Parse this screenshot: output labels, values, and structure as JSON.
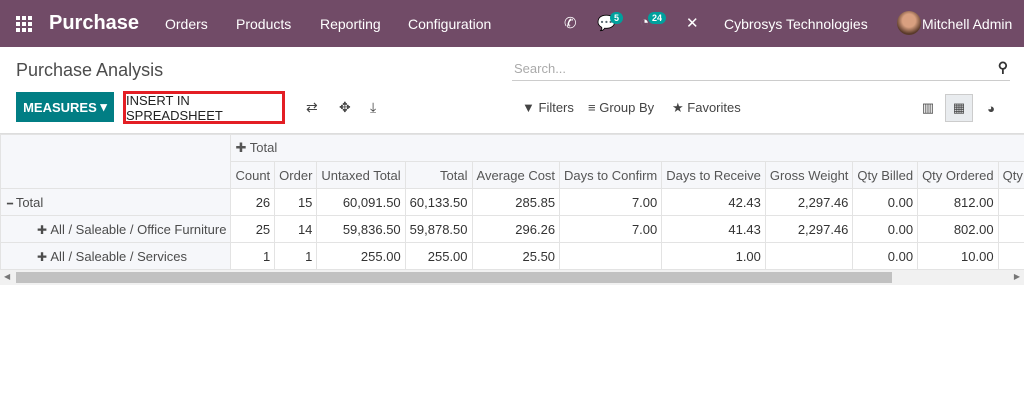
{
  "nav": {
    "app": "Purchase",
    "menus": [
      "Orders",
      "Products",
      "Reporting",
      "Configuration"
    ],
    "messages_badge": "5",
    "activities_badge": "24",
    "company": "Cybrosys Technologies",
    "user": "Mitchell Admin"
  },
  "page": {
    "title": "Purchase Analysis",
    "search_placeholder": "Search..."
  },
  "toolbar": {
    "measures": "MEASURES",
    "insert": "INSERT IN SPREADSHEET",
    "filters": "Filters",
    "group_by": "Group By",
    "favorites": "Favorites"
  },
  "highlight_color": "#e31e24",
  "pivot": {
    "col_header": "Total",
    "measures": [
      "Count",
      "Order",
      "Untaxed Total",
      "Total",
      "Average Cost",
      "Days to Confirm",
      "Days to Receive",
      "Gross Weight",
      "Qty Billed",
      "Qty Ordered",
      "Qty Re"
    ],
    "rows": [
      {
        "label": "Total",
        "values": [
          "26",
          "15",
          "60,091.50",
          "60,133.50",
          "285.85",
          "7.00",
          "42.43",
          "2,297.46",
          "0.00",
          "812.00",
          ""
        ]
      },
      {
        "label": "All / Saleable / Office Furniture",
        "values": [
          "25",
          "14",
          "59,836.50",
          "59,878.50",
          "296.26",
          "7.00",
          "41.43",
          "2,297.46",
          "0.00",
          "802.00",
          ""
        ]
      },
      {
        "label": "All / Saleable / Services",
        "values": [
          "1",
          "1",
          "255.00",
          "255.00",
          "25.50",
          "",
          "1.00",
          "",
          "0.00",
          "10.00",
          ""
        ]
      }
    ]
  }
}
